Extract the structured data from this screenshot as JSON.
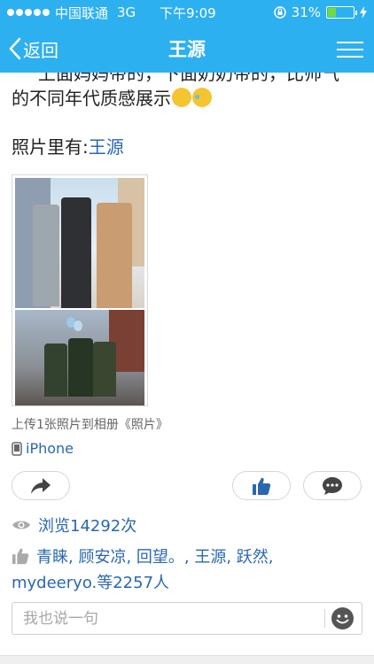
{
  "status_bar": {
    "carrier": "中国联通",
    "network": "3G",
    "time": "下午9:09",
    "battery_percent": "31%",
    "battery_level": 0.31,
    "signal_bars_filled": 5
  },
  "nav": {
    "back_label": "返回",
    "title": "王源",
    "menu_icon": "hamburger-icon"
  },
  "post": {
    "text_line1_cropped": "上面妈妈带的，下面奶奶带的，比帅气",
    "text_line2": "的不同年代质感展示",
    "emojis": [
      "smile-emoji",
      "laugh-cry-emoji"
    ],
    "photo_label": "照片里有:",
    "photo_tag": "王源",
    "upload_caption": "上传1张照片到相册《照片》",
    "device": "iPhone"
  },
  "actions": {
    "share_icon": "share-arrow-icon",
    "like_icon": "thumbs-up-icon",
    "comment_icon": "comment-bubble-icon"
  },
  "stats": {
    "views": "浏览14292次",
    "likers": "青睐, 顾安凉, 回望。, 王源, 跃然, mydeeryo.等2257人"
  },
  "comment_box": {
    "placeholder": "我也说一句",
    "emoji_icon": "smiley-icon"
  },
  "colors": {
    "accent": "#2db0ef",
    "link": "#2a67b0"
  }
}
